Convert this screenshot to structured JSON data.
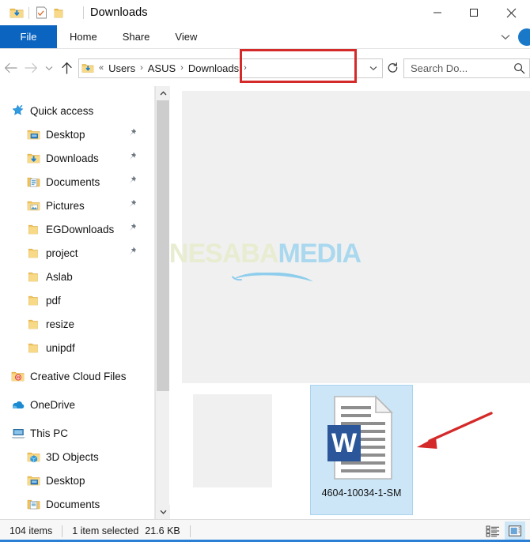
{
  "window": {
    "title": "Downloads",
    "quick_access_icons": [
      "downloads-folder-icon",
      "properties-icon",
      "new-folder-icon",
      "customize-chevron-icon"
    ],
    "controls": {
      "minimize": "—",
      "maximize": "☐",
      "close": "✕"
    }
  },
  "ribbon": {
    "file_tab": "File",
    "tabs": [
      "Home",
      "Share",
      "View"
    ],
    "expand_chevron": "⌄",
    "help_label": "help-icon"
  },
  "address": {
    "back": "←",
    "forward": "→",
    "recent": "⌄",
    "up": "↑",
    "overflow": "«",
    "crumbs": [
      "Users",
      "ASUS",
      "Downloads"
    ],
    "separator": "›",
    "dropdown": "⌄",
    "refresh": "↻"
  },
  "search": {
    "placeholder": "Search Do...",
    "value": "Search Do...",
    "icon": "search-icon"
  },
  "sidebar": {
    "items": [
      {
        "label": "Quick access",
        "icon": "star-icon",
        "indent": false,
        "pinned": false,
        "group": false
      },
      {
        "label": "Desktop",
        "icon": "desktop-folder-icon",
        "indent": true,
        "pinned": true,
        "group": false
      },
      {
        "label": "Downloads",
        "icon": "downloads-folder-icon",
        "indent": true,
        "pinned": true,
        "group": false
      },
      {
        "label": "Documents",
        "icon": "documents-folder-icon",
        "indent": true,
        "pinned": true,
        "group": false
      },
      {
        "label": "Pictures",
        "icon": "pictures-folder-icon",
        "indent": true,
        "pinned": true,
        "group": false
      },
      {
        "label": "EGDownloads",
        "icon": "folder-icon",
        "indent": true,
        "pinned": true,
        "group": false
      },
      {
        "label": "project",
        "icon": "folder-icon",
        "indent": true,
        "pinned": true,
        "group": false
      },
      {
        "label": "Aslab",
        "icon": "folder-icon",
        "indent": true,
        "pinned": false,
        "group": false
      },
      {
        "label": "pdf",
        "icon": "folder-icon",
        "indent": true,
        "pinned": false,
        "group": false
      },
      {
        "label": "resize",
        "icon": "folder-icon",
        "indent": true,
        "pinned": false,
        "group": false
      },
      {
        "label": "unipdf",
        "icon": "folder-icon",
        "indent": true,
        "pinned": false,
        "group": false
      },
      {
        "label": "Creative Cloud Files",
        "icon": "creative-cloud-icon",
        "indent": false,
        "pinned": false,
        "group": true
      },
      {
        "label": "OneDrive",
        "icon": "onedrive-icon",
        "indent": false,
        "pinned": false,
        "group": true
      },
      {
        "label": "This PC",
        "icon": "this-pc-icon",
        "indent": false,
        "pinned": false,
        "group": true
      },
      {
        "label": "3D Objects",
        "icon": "3d-objects-folder-icon",
        "indent": true,
        "pinned": false,
        "group": false
      },
      {
        "label": "Desktop",
        "icon": "desktop-folder-icon",
        "indent": true,
        "pinned": false,
        "group": false
      },
      {
        "label": "Documents",
        "icon": "documents-folder-icon",
        "indent": true,
        "pinned": false,
        "group": false
      }
    ],
    "scroll_up": "⌃",
    "scroll_down": "⌄"
  },
  "content": {
    "watermark": {
      "part1": "NESABA",
      "part2": "MEDIA"
    },
    "files": [
      {
        "name": "",
        "type": "blank-thumbnail",
        "selected": false
      },
      {
        "name": "4604-10034-1-SM",
        "type": "word-document",
        "selected": true
      }
    ]
  },
  "annotations": {
    "address_highlight": "red-rectangle",
    "file_pointer": "red-arrow"
  },
  "status": {
    "item_count": "104 items",
    "selection": "1 item selected",
    "size": "21.6 KB",
    "view_details_icon": "details-view-icon",
    "view_large_icons_icon": "large-icons-view-icon"
  },
  "colors": {
    "accent": "#0b64c0",
    "selection": "#cce6f7",
    "annotation": "#d42a2a",
    "folder": "#f7ce6b",
    "word_blue": "#2b579a"
  }
}
